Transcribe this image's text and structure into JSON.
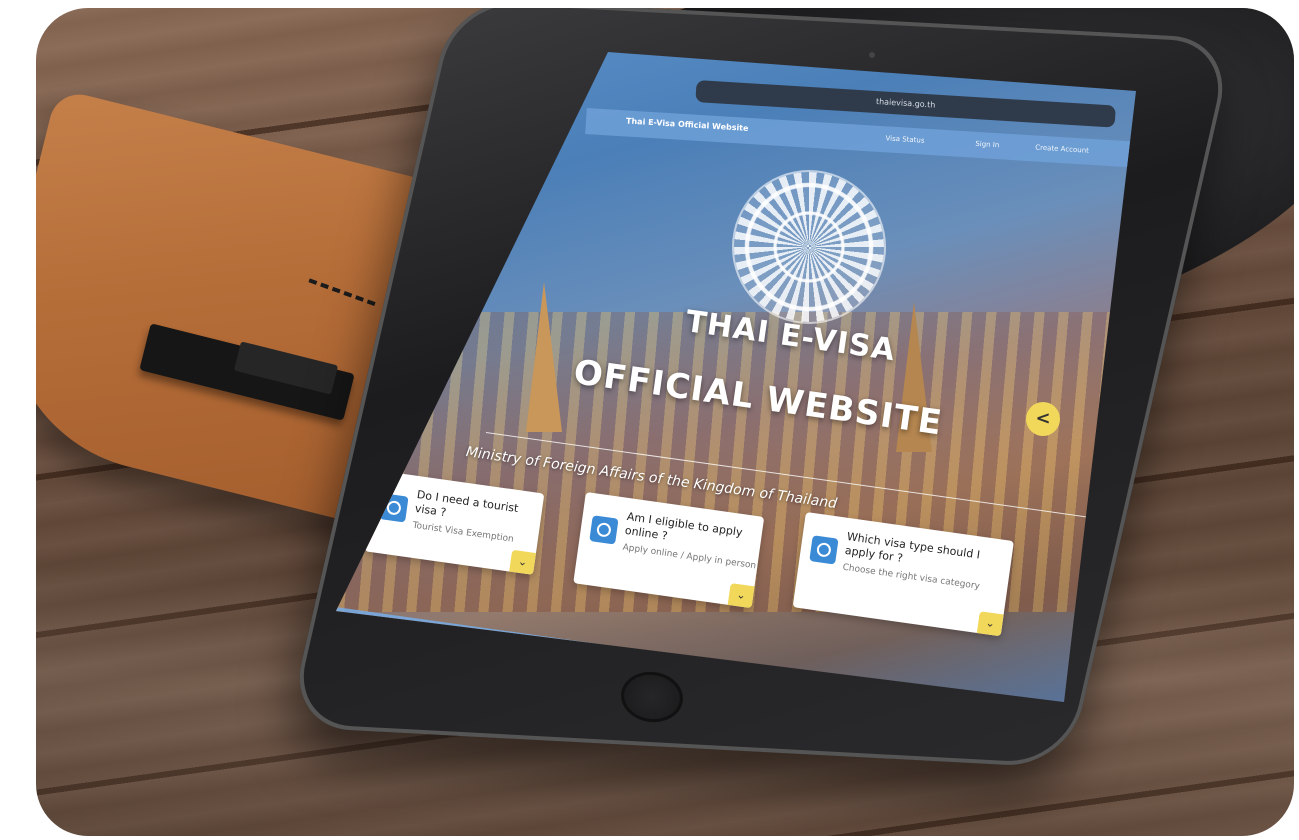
{
  "browser": {
    "url": "thaievisa.go.th"
  },
  "site": {
    "brand": "Thai E-Visa Official Website",
    "nav": [
      "Visa Status",
      "Sign In",
      "Create Account"
    ],
    "hero_line1": "THAI E-VISA",
    "hero_line2": "OFFICIAL WEBSITE",
    "subtitle": "Ministry of Foreign Affairs of the Kingdom of Thailand",
    "side_toggle": "<",
    "cards": [
      {
        "question": "Do I need a tourist visa ?",
        "answer": "Tourist Visa Exemption",
        "icon": "globe-icon"
      },
      {
        "question": "Am I eligible to apply online ?",
        "answer": "Apply online / Apply in person",
        "icon": "id-card-icon"
      },
      {
        "question": "Which visa type should I apply for ?",
        "answer": "Choose the right visa category",
        "icon": "document-icon"
      }
    ],
    "chevron": "⌄"
  },
  "colors": {
    "accent_blue": "#3b8ad6",
    "accent_yellow": "#f2d85a"
  }
}
